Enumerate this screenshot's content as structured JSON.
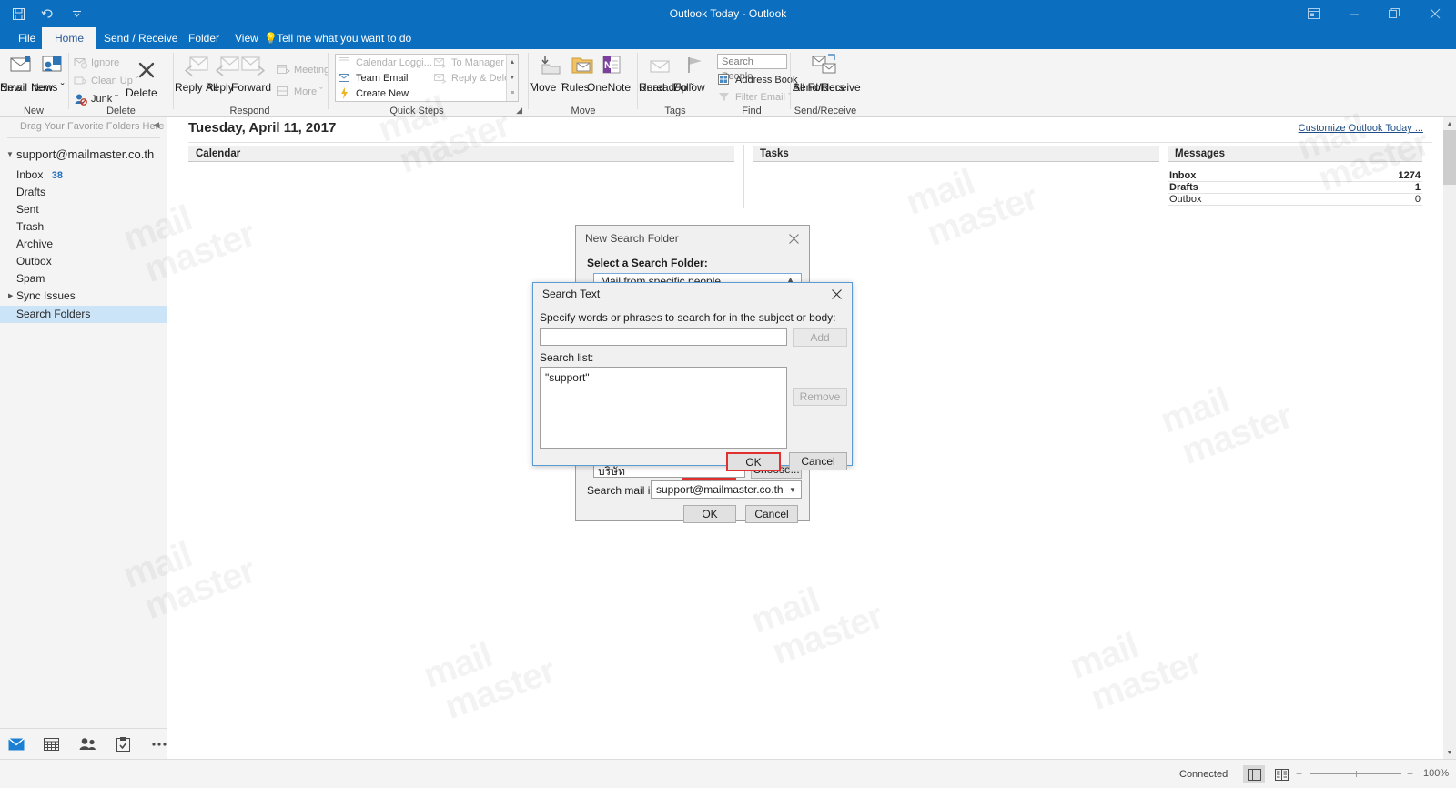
{
  "window": {
    "title": "Outlook Today - Outlook",
    "quick_access": [
      "save-icon",
      "undo-icon",
      "customize-qat-icon"
    ],
    "controls": [
      "ribbon-display-options-icon",
      "minimize-icon",
      "restore-icon",
      "close-icon"
    ]
  },
  "ribbon": {
    "tabs": [
      {
        "label": "File",
        "active": false
      },
      {
        "label": "Home",
        "active": true
      },
      {
        "label": "Send / Receive",
        "active": false
      },
      {
        "label": "Folder",
        "active": false
      },
      {
        "label": "View",
        "active": false
      }
    ],
    "tell_me": "Tell me what you want to do",
    "groups": [
      {
        "name": "New",
        "label": "New",
        "buttons": [
          {
            "label_line1": "New",
            "label_line2": "Email",
            "dim": false
          },
          {
            "label_line1": "New",
            "label_line2": "Items ˇ",
            "dim": false
          }
        ]
      },
      {
        "name": "Delete",
        "label": "Delete",
        "small_buttons": [
          {
            "label": "Ignore",
            "dim": true
          },
          {
            "label": "Clean Up ˇ",
            "dim": true
          },
          {
            "label": "Junk ˇ",
            "dim": false
          }
        ],
        "big_button": {
          "label": "Delete",
          "dim": false
        }
      },
      {
        "name": "Respond",
        "label": "Respond",
        "buttons": [
          {
            "label_line1": "Reply",
            "label_line2": "",
            "dim": true
          },
          {
            "label_line1": "Reply",
            "label_line2": "All",
            "dim": true
          },
          {
            "label_line1": "Forward",
            "label_line2": "",
            "dim": true
          }
        ],
        "small_buttons": [
          {
            "label": "Meeting",
            "dim": true
          },
          {
            "label": "More ˇ",
            "dim": true
          }
        ]
      },
      {
        "name": "Quick Steps",
        "label": "Quick Steps",
        "items": [
          {
            "label": "Calendar Loggi...",
            "dim": true
          },
          {
            "label": "To Manager",
            "dim": true
          },
          {
            "label": "Team Email",
            "dim": false
          },
          {
            "label": "Reply & Delete",
            "dim": true
          },
          {
            "label": "Create New",
            "dim": false
          }
        ]
      },
      {
        "name": "Move",
        "label": "Move",
        "buttons": [
          {
            "label_line1": "Move",
            "label_line2": "ˇ",
            "dim": false
          },
          {
            "label_line1": "Rules",
            "label_line2": "ˇ",
            "dim": false
          },
          {
            "label_line1": "OneNote",
            "label_line2": "",
            "dim": false
          }
        ]
      },
      {
        "name": "Tags",
        "label": "Tags",
        "buttons": [
          {
            "label_line1": "Unread/",
            "label_line2": "Read",
            "dim": true
          },
          {
            "label_line1": "Follow",
            "label_line2": "Up ˇ",
            "dim": false
          }
        ]
      },
      {
        "name": "Find",
        "label": "Find",
        "search_people_placeholder": "Search People",
        "items": [
          {
            "label": "Address Book",
            "dim": false
          },
          {
            "label": "Filter Email ˇ",
            "dim": true
          }
        ]
      },
      {
        "name": "Send/Receive",
        "label": "Send/Receive",
        "buttons": [
          {
            "label_line1": "Send/Receive",
            "label_line2": "All Folders",
            "dim": false
          }
        ]
      }
    ]
  },
  "nav": {
    "favorites_hint": "Drag Your Favorite Folders Here",
    "account": "support@mailmaster.co.th",
    "folders": [
      {
        "label": "Inbox",
        "count": "38",
        "selected": false,
        "expandable": false
      },
      {
        "label": "Drafts",
        "count": "",
        "selected": false,
        "expandable": false
      },
      {
        "label": "Sent",
        "count": "",
        "selected": false,
        "expandable": false
      },
      {
        "label": "Trash",
        "count": "",
        "selected": false,
        "expandable": false
      },
      {
        "label": "Archive",
        "count": "",
        "selected": false,
        "expandable": false
      },
      {
        "label": "Outbox",
        "count": "",
        "selected": false,
        "expandable": false
      },
      {
        "label": "Spam",
        "count": "",
        "selected": false,
        "expandable": false
      },
      {
        "label": "Sync Issues",
        "count": "",
        "selected": false,
        "expandable": true
      },
      {
        "label": "Search Folders",
        "count": "",
        "selected": true,
        "expandable": false
      }
    ],
    "modules": [
      "mail-icon",
      "calendar-icon",
      "people-icon",
      "tasks-icon",
      "more-icon"
    ]
  },
  "today": {
    "date": "Tuesday, April 11, 2017",
    "customize_link": "Customize Outlook Today ...",
    "calendar_header": "Calendar",
    "tasks_header": "Tasks",
    "messages_header": "Messages",
    "messages": [
      {
        "name": "Inbox",
        "value": "1274",
        "bold": true
      },
      {
        "name": "Drafts",
        "value": "1",
        "bold": true
      },
      {
        "name": "Outbox",
        "value": "0",
        "bold": false
      }
    ]
  },
  "new_search_folder_dialog": {
    "title": "New Search Folder",
    "close_label": "✕",
    "select_label": "Select a Search Folder:",
    "selected_folder": "Mail from specific people",
    "customize_value": "บริษัท",
    "choose_button": "Choose...",
    "search_mail_in_label": "Search mail in:",
    "search_mail_in_value": "support@mailmaster.co.th",
    "ok_button": "OK",
    "cancel_button": "Cancel"
  },
  "search_text_dialog": {
    "title": "Search Text",
    "close_label": "✕",
    "prompt": "Specify words or phrases to search for in the subject or body:",
    "input_value": "",
    "add_button": "Add",
    "search_list_label": "Search list:",
    "search_list_items": [
      "\"support\""
    ],
    "remove_button": "Remove",
    "ok_button": "OK",
    "cancel_button": "Cancel",
    "highlight_color": "#e03030"
  },
  "statusbar": {
    "connection": "Connected",
    "zoom_value": "100%",
    "zoom_out": "−",
    "zoom_in": "+",
    "view_buttons": [
      "normal-view-icon",
      "reading-view-icon"
    ]
  },
  "watermark": {
    "line1": "mail",
    "line2": "master"
  }
}
